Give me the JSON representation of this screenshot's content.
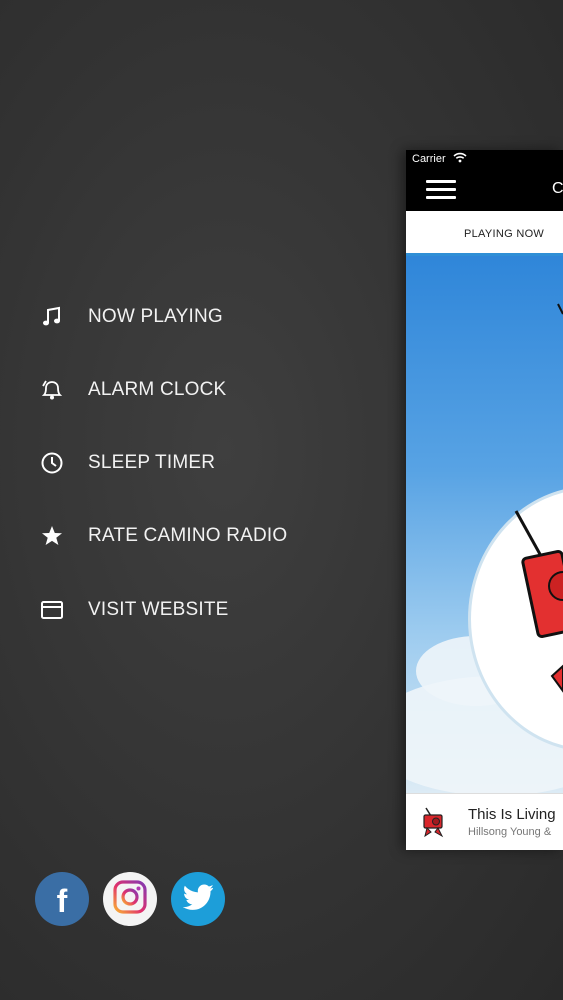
{
  "menu": {
    "items": [
      {
        "label": "NOW PLAYING",
        "icon": "music-note-icon"
      },
      {
        "label": "ALARM CLOCK",
        "icon": "bell-icon"
      },
      {
        "label": "SLEEP TIMER",
        "icon": "clock-icon"
      },
      {
        "label": "RATE CAMINO RADIO",
        "icon": "star-icon"
      },
      {
        "label": "VISIT WEBSITE",
        "icon": "browser-window-icon"
      }
    ]
  },
  "social": {
    "facebook_glyph": "f",
    "icons": [
      "facebook-icon",
      "instagram-icon",
      "twitter-icon"
    ],
    "colors": {
      "facebook": "#3a6ea5",
      "instagram": "#f4f4f4",
      "twitter": "#1d9ed9"
    }
  },
  "app_preview": {
    "status": {
      "carrier": "Carrier"
    },
    "nav": {
      "title_partial": "C"
    },
    "tab": {
      "label": "PLAYING NOW",
      "accent": "#2f8fd6"
    },
    "player": {
      "song": "This Is Living",
      "artist": "Hillsong Young &"
    }
  }
}
